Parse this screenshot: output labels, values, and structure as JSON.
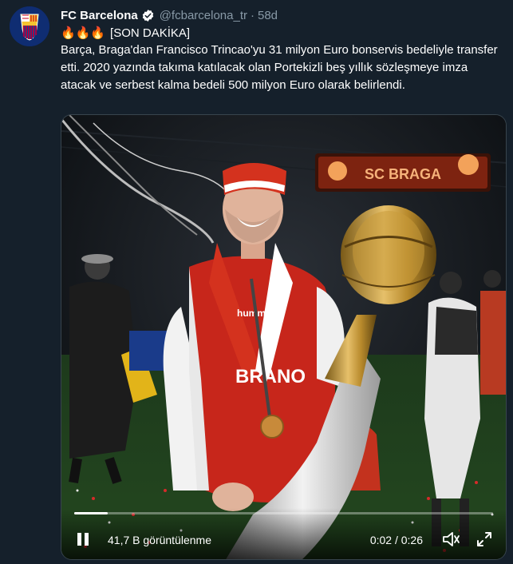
{
  "tweet": {
    "author_name": "FC Barcelona",
    "handle": "@fcbarcelona_tr",
    "separator": "·",
    "time": "58d",
    "emoji_line": "🔥🔥🔥",
    "tag": "[SON DAKİKA]",
    "body": "Barça, Braga'dan Francisco Trincao'yu 31 milyon Euro bonservis bedeliyle transfer etti. 2020 yazında takıma katılacak olan Portekizli beş yıllık sözleşmeye imza atacak ve serbest kalma bedeli 500 milyon Euro olarak belirlendi."
  },
  "video": {
    "views": "41,7 B görüntülenme",
    "timecode": "0:02 / 0:26",
    "progress": 0.08,
    "scene_text": {
      "banner": "SC BRAGA",
      "shirt_brand": "hummel",
      "shirt_sponsor": "BRANO"
    }
  },
  "icons": {
    "avatar": "fc-barcelona-crest-icon",
    "verified": "verified-badge-icon",
    "pause": "pause-icon",
    "volume": "volume-icon",
    "fullscreen": "fullscreen-icon"
  },
  "colors": {
    "background": "#15202b",
    "secondary_text": "#8899a6",
    "verified": "#ffffff",
    "border": "#38444d"
  }
}
